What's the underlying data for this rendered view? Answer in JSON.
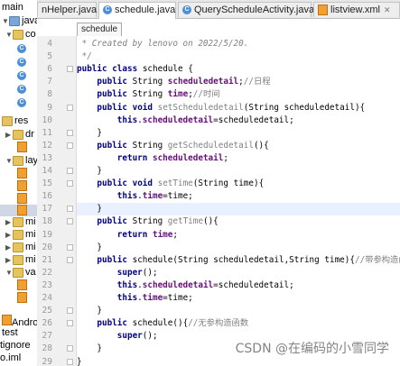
{
  "tabs": [
    {
      "label": "nHelper.java",
      "icon": "class-icon"
    },
    {
      "label": "schedule.java",
      "icon": "class-icon",
      "active": true
    },
    {
      "label": "QueryScheduleActivity.java",
      "icon": "class-icon"
    },
    {
      "label": "listview.xml",
      "icon": "xml-icon"
    }
  ],
  "breadcrumb": "schedule",
  "tree": {
    "items": [
      "main",
      "java",
      "co",
      "res",
      "dr",
      "lay",
      "mi",
      "mi",
      "mi",
      "mi",
      "va",
      "Andro",
      "test",
      "tignore",
      "o.iml"
    ]
  },
  "editor": {
    "lines": [
      {
        "num": "4",
        "text": " * Created by lenovo on 2022/5/20."
      },
      {
        "num": "5",
        "text": " */"
      },
      {
        "num": "6",
        "text": "public class schedule {"
      },
      {
        "num": "7",
        "text": "    public String scheduledetail;//日程"
      },
      {
        "num": "8",
        "text": "    public String time;//时间"
      },
      {
        "num": "9",
        "text": "    public void setScheduledetail(String scheduledetail){"
      },
      {
        "num": "10",
        "text": "        this.scheduledetail=scheduledetail;"
      },
      {
        "num": "11",
        "text": "    }"
      },
      {
        "num": "12",
        "text": "    public String getScheduledetail(){"
      },
      {
        "num": "13",
        "text": "        return scheduledetail;"
      },
      {
        "num": "14",
        "text": "    }"
      },
      {
        "num": "15",
        "text": "    public void setTime(String time){"
      },
      {
        "num": "16",
        "text": "        this.time=time;"
      },
      {
        "num": "17",
        "text": "    }"
      },
      {
        "num": "18",
        "text": "    public String getTime(){"
      },
      {
        "num": "19",
        "text": "        return time;"
      },
      {
        "num": "20",
        "text": "    }"
      },
      {
        "num": "21",
        "text": "    public schedule(String scheduledetail,String time){//带参构造函数"
      },
      {
        "num": "22",
        "text": "        super();"
      },
      {
        "num": "23",
        "text": "        this.scheduledetail=scheduledetail;"
      },
      {
        "num": "24",
        "text": "        this.time=time;"
      },
      {
        "num": "25",
        "text": "    }"
      },
      {
        "num": "26",
        "text": "    public schedule(){//无参构造函数"
      },
      {
        "num": "27",
        "text": "        super();"
      },
      {
        "num": "28",
        "text": "    }"
      },
      {
        "num": "29",
        "text": "}"
      }
    ],
    "current_line": "17"
  },
  "watermark": "CSDN @在编码的小雪同学",
  "colors": {
    "keyword": "#000080",
    "field": "#660e7a",
    "comment": "#808080",
    "current_line": "#e9f0ff"
  }
}
